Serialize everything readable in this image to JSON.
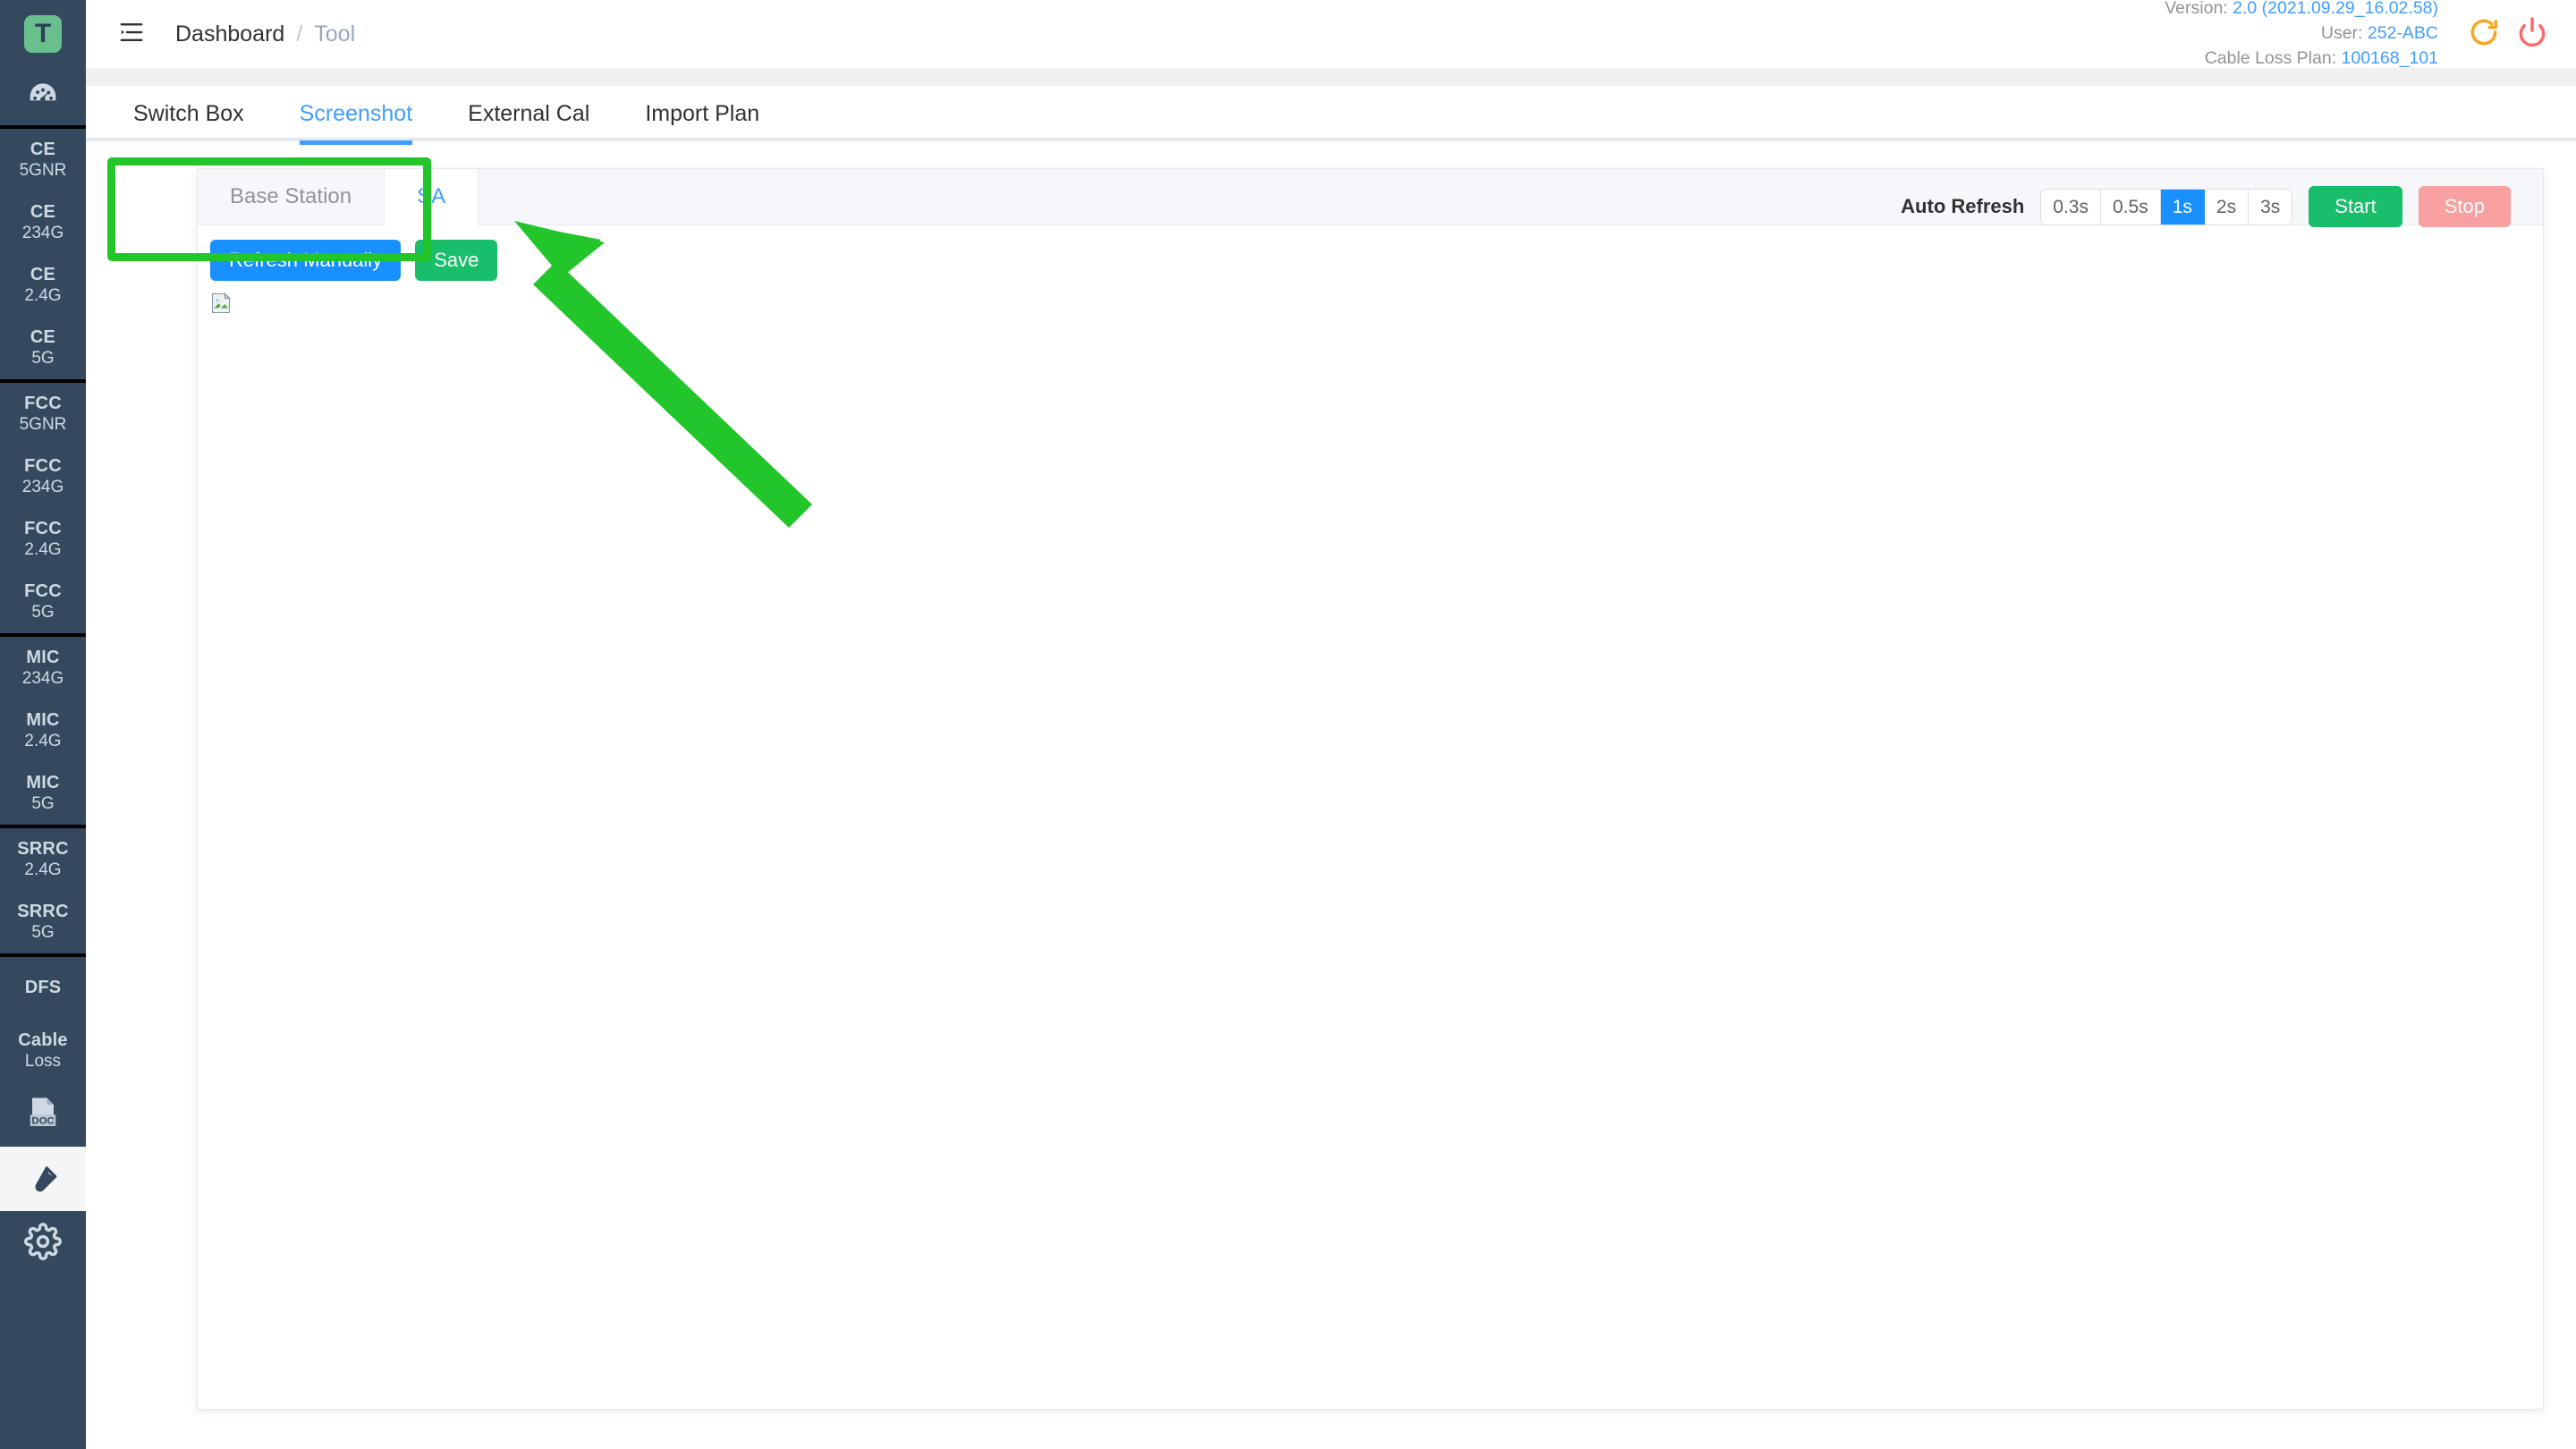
{
  "sidebar": {
    "logo_letter": "T",
    "dashboard_icon": "gauge-icon",
    "groups": [
      {
        "items": [
          {
            "l1": "CE",
            "l2": "5GNR"
          },
          {
            "l1": "CE",
            "l2": "234G"
          },
          {
            "l1": "CE",
            "l2": "2.4G"
          },
          {
            "l1": "CE",
            "l2": "5G"
          }
        ]
      },
      {
        "items": [
          {
            "l1": "FCC",
            "l2": "5GNR"
          },
          {
            "l1": "FCC",
            "l2": "234G"
          },
          {
            "l1": "FCC",
            "l2": "2.4G"
          },
          {
            "l1": "FCC",
            "l2": "5G"
          }
        ]
      },
      {
        "items": [
          {
            "l1": "MIC",
            "l2": "234G"
          },
          {
            "l1": "MIC",
            "l2": "2.4G"
          },
          {
            "l1": "MIC",
            "l2": "5G"
          }
        ]
      },
      {
        "items": [
          {
            "l1": "SRRC",
            "l2": "2.4G"
          },
          {
            "l1": "SRRC",
            "l2": "5G"
          }
        ]
      },
      {
        "items": [
          {
            "l1": "DFS",
            "l2": ""
          },
          {
            "l1": "Cable",
            "l2": "Loss"
          }
        ]
      }
    ],
    "doc_icon_label": "DOC",
    "tool_icon": "wrench-icon",
    "settings_icon": "gear-icon"
  },
  "header": {
    "collapse_icon": "menu-collapse-icon",
    "breadcrumb": {
      "root": "Dashboard",
      "separator": "/",
      "current": "Tool"
    },
    "info": {
      "version_label": "Version:",
      "version_value": "2.0 (2021.09.29_16.02.58)",
      "user_label": "User:",
      "user_value": "252-ABC",
      "plan_label": "Cable Loss Plan:",
      "plan_value": "100168_101"
    },
    "refresh_icon": "refresh-icon",
    "power_icon": "power-icon"
  },
  "main_tabs": [
    {
      "label": "Switch Box",
      "active": false
    },
    {
      "label": "Screenshot",
      "active": true
    },
    {
      "label": "External Cal",
      "active": false
    },
    {
      "label": "Import Plan",
      "active": false
    }
  ],
  "sub_tabs": [
    {
      "label": "Base Station",
      "active": false
    },
    {
      "label": "SA",
      "active": true
    }
  ],
  "actions": {
    "refresh_manually": "Refresh Manually",
    "save": "Save"
  },
  "auto_refresh": {
    "label": "Auto Refresh",
    "options": [
      {
        "label": "0.3s",
        "active": false
      },
      {
        "label": "0.5s",
        "active": false
      },
      {
        "label": "1s",
        "active": true
      },
      {
        "label": "2s",
        "active": false
      },
      {
        "label": "3s",
        "active": false
      }
    ],
    "start": "Start",
    "stop": "Stop"
  },
  "preview": {
    "image_icon": "broken-image-icon"
  },
  "annotations": {
    "highlight_target": "sub-tab-bar",
    "arrow": "green-arrow-pointing-up-left"
  },
  "colors": {
    "sidebar_bg": "#34495e",
    "logo_green": "#6abf8e",
    "accent_blue": "#409eff",
    "button_blue": "#1890ff",
    "green": "#19be6b",
    "stop_red": "#f9a0a0",
    "refresh_orange": "#f5a623",
    "power_red": "#fa6a6a",
    "annotation_green": "#22c52a"
  }
}
